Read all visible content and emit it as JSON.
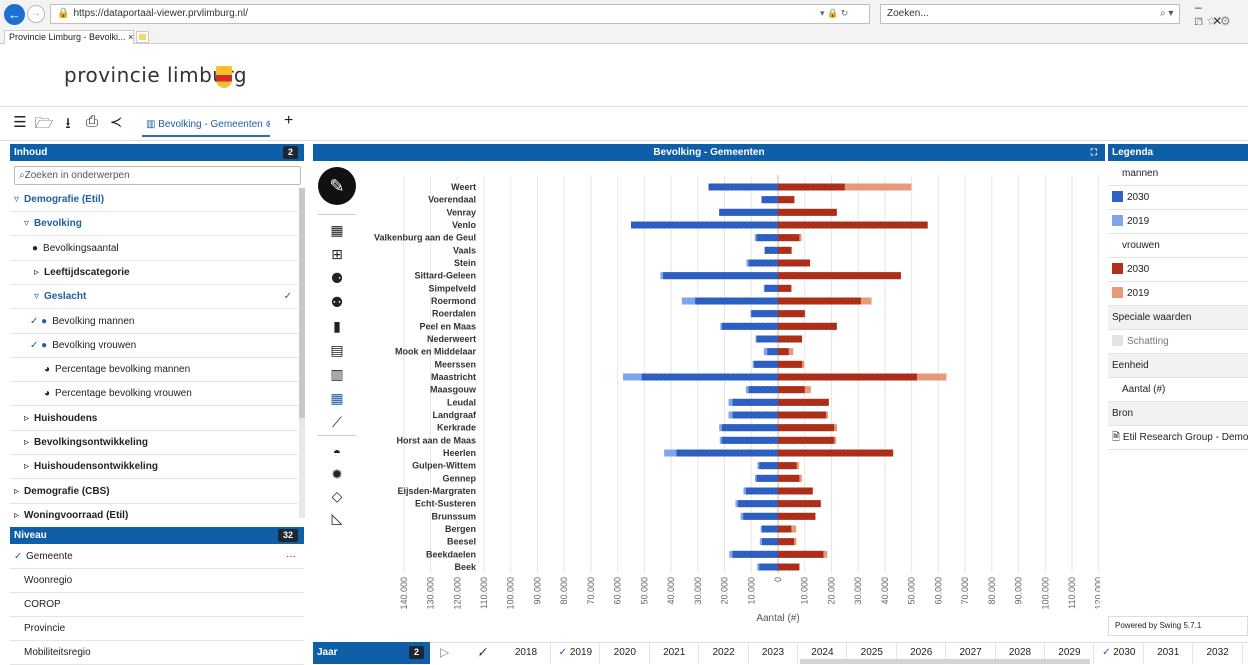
{
  "browser": {
    "url": "https://dataportaal-viewer.prvlimburg.nl/",
    "search_placeholder": "Zoeken...",
    "tab_title": "Provincie Limburg - Bevolki..."
  },
  "header": {
    "logo_text": "provincie limburg"
  },
  "toolbar": {
    "document_tab": "Bevolking - Gemeenten",
    "add_label": "+"
  },
  "inhoud": {
    "title": "Inhoud",
    "count": "2",
    "search_placeholder": "Zoeken in onderwerpen",
    "items": [
      {
        "label": "Demografie (Etil)",
        "prefix": "▿"
      },
      {
        "label": "Bevolking",
        "prefix": "▿"
      },
      {
        "label": "Bevolkingsaantal",
        "prefix": "●"
      },
      {
        "label": "Leeftijdscategorie",
        "prefix": "▹"
      },
      {
        "label": "Geslacht",
        "prefix": "▿"
      },
      {
        "label": "Bevolking mannen",
        "prefix": "✓ ●"
      },
      {
        "label": "Bevolking vrouwen",
        "prefix": "✓ ●"
      },
      {
        "label": "Percentage bevolking mannen",
        "prefix": "◕"
      },
      {
        "label": "Percentage bevolking vrouwen",
        "prefix": "◕"
      },
      {
        "label": "Huishoudens",
        "prefix": "▹"
      },
      {
        "label": "Bevolkingsontwikkeling",
        "prefix": "▹"
      },
      {
        "label": "Huishoudensontwikkeling",
        "prefix": "▹"
      },
      {
        "label": "Demografie (CBS)",
        "prefix": "▹"
      },
      {
        "label": "Woningvoorraad (Etil)",
        "prefix": "▹"
      }
    ]
  },
  "niveau": {
    "title": "Niveau",
    "count": "32",
    "items": [
      {
        "label": "Gemeente",
        "prefix": "✓"
      },
      {
        "label": "Woonregio",
        "prefix": ""
      },
      {
        "label": "COROP",
        "prefix": ""
      },
      {
        "label": "Provincie",
        "prefix": ""
      },
      {
        "label": "Mobiliteitsregio",
        "prefix": ""
      }
    ],
    "more": "···"
  },
  "chart_panel": {
    "title": "Bevolking - Gemeenten"
  },
  "legend": {
    "title": "Legenda",
    "group_men": "mannen",
    "men_2030": "2030",
    "men_2019": "2019",
    "group_women": "vrouwen",
    "women_2030": "2030",
    "women_2019": "2019",
    "special_header": "Speciale waarden",
    "estimate": "Schatting",
    "unit_header": "Eenheid",
    "unit": "Aantal (#)",
    "source_header": "Bron",
    "source": "Etil Research Group - Demog",
    "powered": "Powered by Swing 5.7.1",
    "colors": {
      "men_2030": "#2f63c9",
      "men_2019": "#7fa6ec",
      "women_2030": "#b3301a",
      "women_2019": "#e69a78"
    }
  },
  "timeline": {
    "label": "Jaar",
    "count": "2",
    "years": [
      {
        "label": "2018",
        "selected": false
      },
      {
        "label": "2019",
        "selected": true
      },
      {
        "label": "2020",
        "selected": false
      },
      {
        "label": "2021",
        "selected": false
      },
      {
        "label": "2022",
        "selected": false
      },
      {
        "label": "2023",
        "selected": false
      },
      {
        "label": "2024",
        "selected": false
      },
      {
        "label": "2025",
        "selected": false
      },
      {
        "label": "2026",
        "selected": false
      },
      {
        "label": "2027",
        "selected": false
      },
      {
        "label": "2028",
        "selected": false
      },
      {
        "label": "2029",
        "selected": false
      },
      {
        "label": "2030",
        "selected": true
      },
      {
        "label": "2031",
        "selected": false
      },
      {
        "label": "2032",
        "selected": false
      }
    ]
  },
  "chart_data": {
    "type": "bar",
    "orientation": "horizontal-diverging",
    "xlabel": "Aantal (#)",
    "xlim": [
      -140000,
      140000
    ],
    "ticks": [
      "140.000",
      "130.000",
      "120.000",
      "110.000",
      "100.000",
      "90.000",
      "80.000",
      "70.000",
      "60.000",
      "50.000",
      "40.000",
      "30.000",
      "20.000",
      "10.000",
      "0",
      "10.000",
      "20.000",
      "30.000",
      "40.000",
      "50.000",
      "60.000",
      "70.000",
      "80.000",
      "90.000",
      "100.000",
      "110.000",
      "120.000",
      "130.000",
      "140.000"
    ],
    "categories": [
      "Weert",
      "Voerendaal",
      "Venray",
      "Venlo",
      "Valkenburg aan de Geul",
      "Vaals",
      "Stein",
      "Sittard-Geleen",
      "Simpelveld",
      "Roermond",
      "Roerdalen",
      "Peel en Maas",
      "Nederweert",
      "Mook en Middelaar",
      "Meerssen",
      "Maastricht",
      "Maasgouw",
      "Leudal",
      "Landgraaf",
      "Kerkrade",
      "Horst aan de Maas",
      "Heerlen",
      "Gulpen-Wittem",
      "Gennep",
      "Eijsden-Margraten",
      "Echt-Susteren",
      "Brunssum",
      "Bergen",
      "Beesel",
      "Beekdaelen",
      "Beek"
    ],
    "series": [
      {
        "name": "mannen 2019",
        "values": [
          24900,
          6300,
          21000,
          49900,
          8700,
          5000,
          11800,
          44000,
          5300,
          36000,
          10300,
          21600,
          8400,
          5300,
          9500,
          58000,
          12000,
          18500,
          18500,
          22000,
          21800,
          42600,
          7700,
          8600,
          12900,
          15900,
          14000,
          6500,
          6800,
          18200,
          7800
        ]
      },
      {
        "name": "mannen 2030",
        "values": [
          26000,
          6000,
          22000,
          55000,
          8000,
          5000,
          11000,
          43000,
          5000,
          31000,
          10000,
          21000,
          8000,
          4000,
          9000,
          51000,
          11000,
          17000,
          17000,
          21000,
          21000,
          38000,
          7000,
          8000,
          12000,
          15000,
          13000,
          6000,
          6000,
          17000,
          7000
        ]
      },
      {
        "name": "vrouwen 2019",
        "values": [
          49900,
          6300,
          21300,
          51100,
          8800,
          5200,
          11700,
          45000,
          5000,
          35000,
          10200,
          21300,
          8400,
          5700,
          9800,
          63000,
          12300,
          19000,
          18700,
          22100,
          21800,
          43200,
          7900,
          8900,
          12600,
          15700,
          14000,
          6800,
          6900,
          18400,
          8000
        ]
      },
      {
        "name": "vrouwen 2030",
        "values": [
          25000,
          6000,
          22000,
          56000,
          8000,
          5000,
          12000,
          46000,
          5000,
          31000,
          10000,
          22000,
          9000,
          4000,
          9000,
          52000,
          10000,
          19000,
          18000,
          21000,
          21000,
          43000,
          7000,
          8000,
          13000,
          16000,
          14000,
          5000,
          6000,
          17000,
          8000
        ]
      }
    ]
  }
}
